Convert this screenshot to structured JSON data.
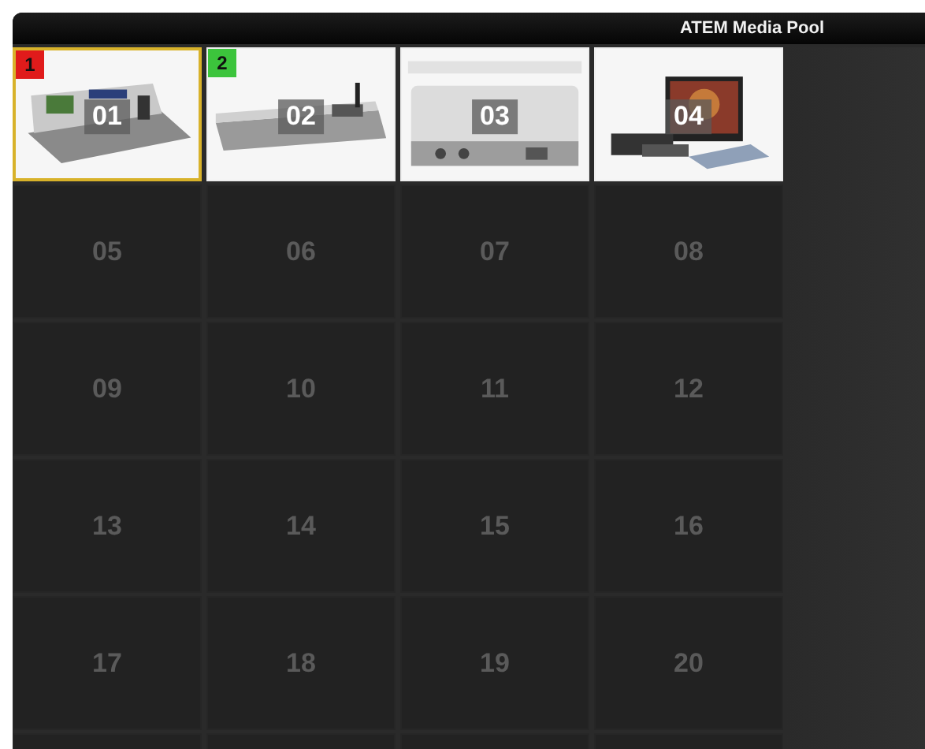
{
  "window": {
    "title": "ATEM Media Pool"
  },
  "clips": [
    {
      "label": "01",
      "kind": "picture",
      "selected": true,
      "badge": {
        "text": "1",
        "color": "#e01b1b"
      }
    },
    {
      "label": "02",
      "kind": "picture",
      "selected": false,
      "badge": {
        "text": "2",
        "color": "#3cc43c"
      }
    },
    {
      "label": "03",
      "kind": "picture",
      "selected": false
    },
    {
      "label": "04",
      "kind": "picture",
      "selected": false
    },
    {
      "label": "05",
      "kind": "empty",
      "selected": false
    },
    {
      "label": "06",
      "kind": "empty",
      "selected": false
    },
    {
      "label": "07",
      "kind": "empty",
      "selected": false
    },
    {
      "label": "08",
      "kind": "empty",
      "selected": false
    },
    {
      "label": "09",
      "kind": "empty",
      "selected": false
    },
    {
      "label": "10",
      "kind": "empty",
      "selected": false
    },
    {
      "label": "11",
      "kind": "empty",
      "selected": false
    },
    {
      "label": "12",
      "kind": "empty",
      "selected": false
    },
    {
      "label": "13",
      "kind": "empty",
      "selected": false
    },
    {
      "label": "14",
      "kind": "empty",
      "selected": false
    },
    {
      "label": "15",
      "kind": "empty",
      "selected": false
    },
    {
      "label": "16",
      "kind": "empty",
      "selected": false
    },
    {
      "label": "17",
      "kind": "empty",
      "selected": false
    },
    {
      "label": "18",
      "kind": "empty",
      "selected": false
    },
    {
      "label": "19",
      "kind": "empty",
      "selected": false
    },
    {
      "label": "20",
      "kind": "empty",
      "selected": false
    },
    {
      "kind": "empty",
      "selected": false
    },
    {
      "kind": "empty",
      "selected": false
    },
    {
      "kind": "empty",
      "selected": false
    },
    {
      "kind": "empty",
      "selected": false
    }
  ]
}
